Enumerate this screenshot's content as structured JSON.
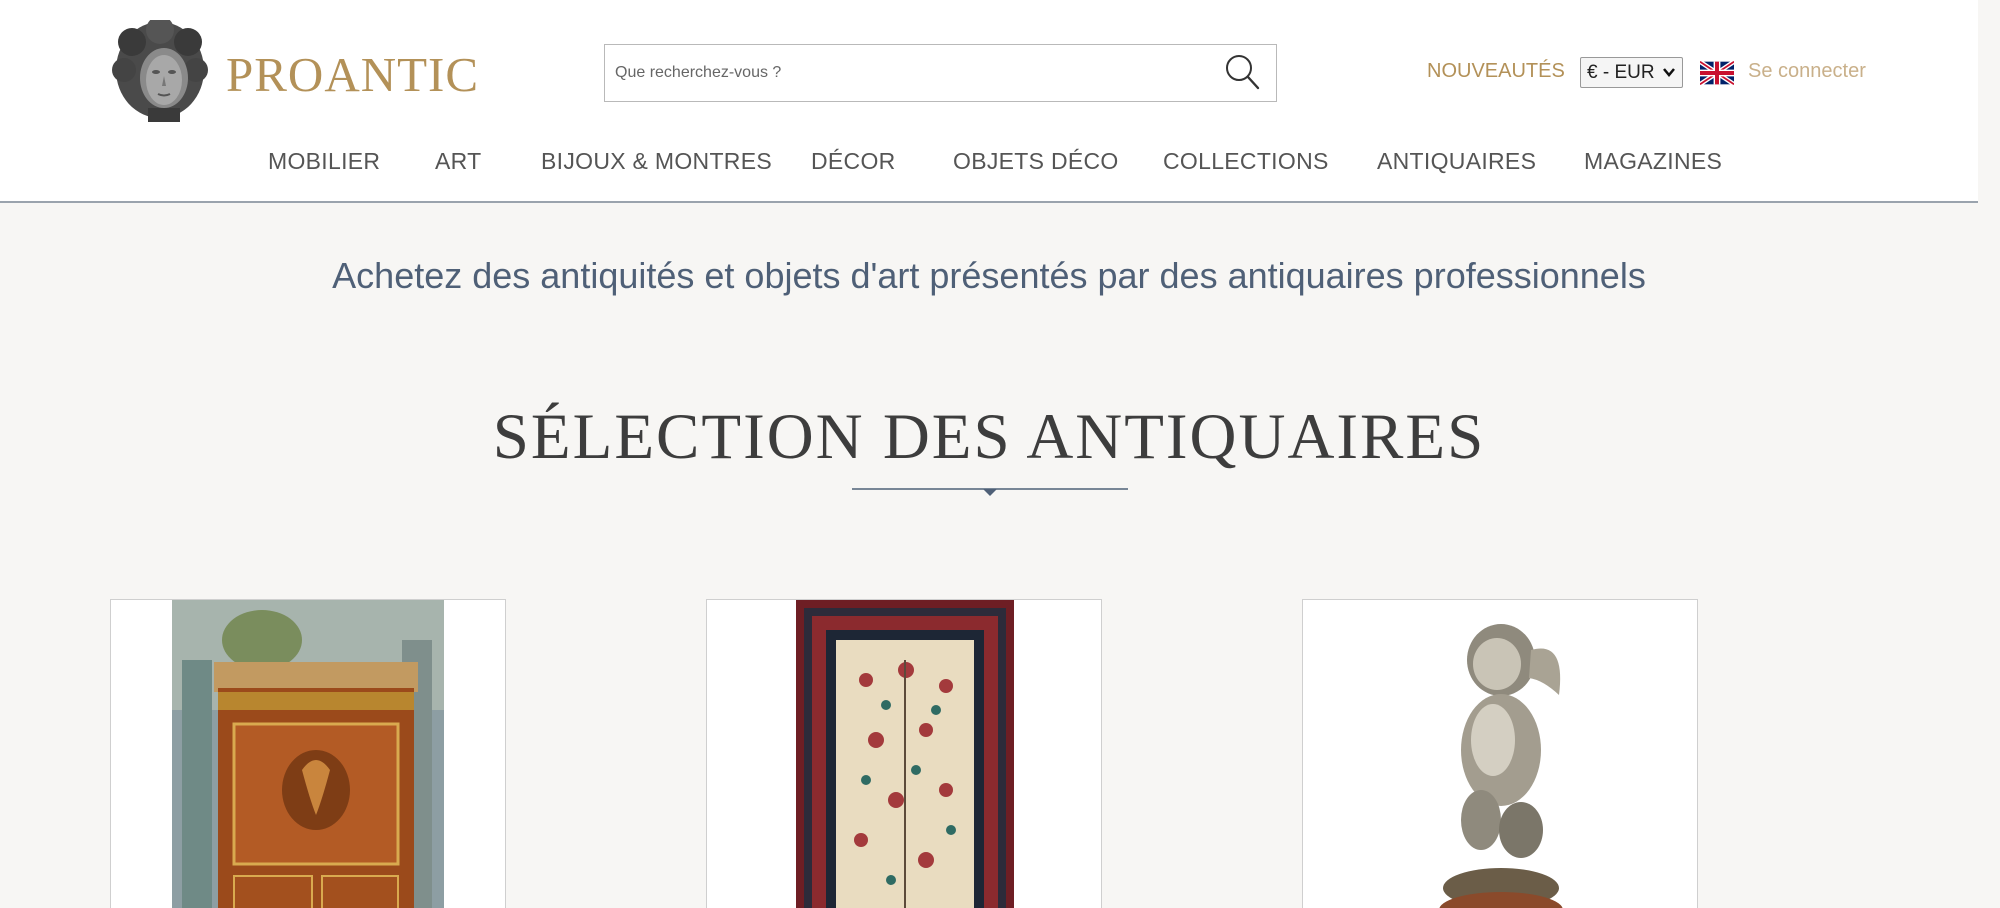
{
  "header": {
    "brand": "PROANTIC",
    "search": {
      "placeholder": "Que recherchez-vous ?",
      "value": ""
    },
    "nouveautes": "NOUVEAUTÉS",
    "currency": "€ - EUR",
    "language_flag": "uk-flag-icon",
    "login": "Se connecter"
  },
  "nav": {
    "items": [
      {
        "label": "MOBILIER"
      },
      {
        "label": "ART"
      },
      {
        "label": "BIJOUX & MONTRES"
      },
      {
        "label": "DÉCOR"
      },
      {
        "label": "OBJETS DÉCO"
      },
      {
        "label": "COLLECTIONS"
      },
      {
        "label": "ANTIQUAIRES"
      },
      {
        "label": "MAGAZINES"
      }
    ]
  },
  "main": {
    "tagline": "Achetez des antiquités et objets d'art présentés par des antiquaires professionnels",
    "section_title": "SÉLECTION DES ANTIQUAIRES",
    "products": [
      {
        "image": "secretary-desk-image"
      },
      {
        "image": "persian-rug-image"
      },
      {
        "image": "bronze-cherub-image"
      }
    ]
  },
  "colors": {
    "brand": "#b39158",
    "tagline": "#4f6077",
    "login": "#c9b08a"
  }
}
